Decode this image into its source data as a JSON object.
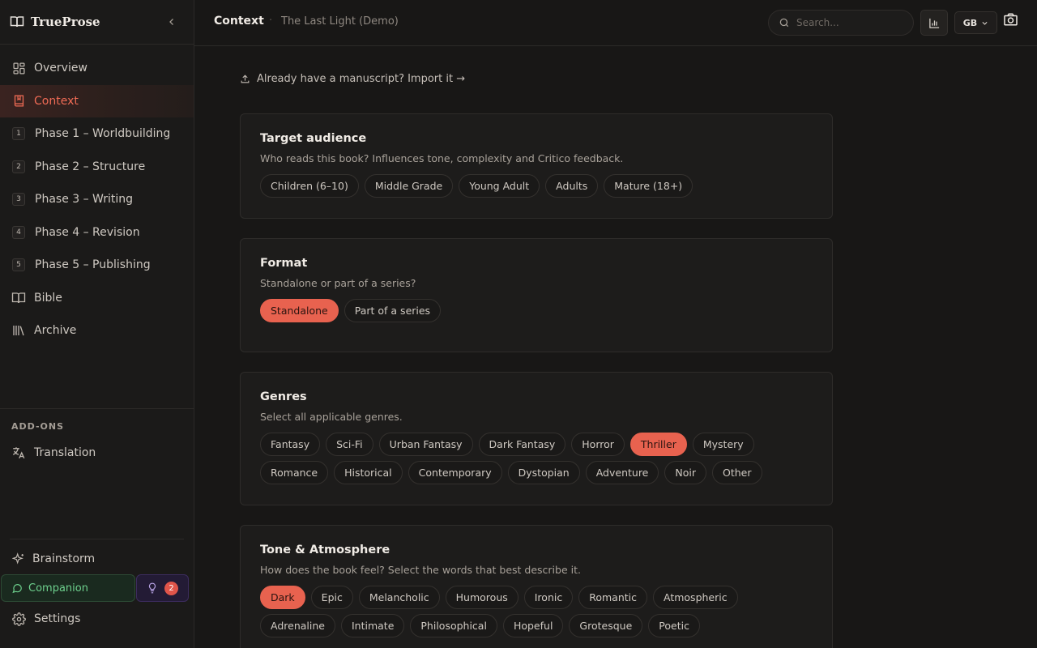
{
  "app": {
    "name": "TrueProse"
  },
  "sidebar": {
    "nav": [
      {
        "label": "Overview",
        "icon": "grid-icon"
      },
      {
        "label": "Context",
        "icon": "book-bookmark-icon",
        "active": true
      },
      {
        "label": "Phase 1 – Worldbuilding",
        "badge": "1"
      },
      {
        "label": "Phase 2 – Structure",
        "badge": "2"
      },
      {
        "label": "Phase 3 – Writing",
        "badge": "3"
      },
      {
        "label": "Phase 4 – Revision",
        "badge": "4"
      },
      {
        "label": "Phase 5 – Publishing",
        "badge": "5"
      },
      {
        "label": "Bible",
        "icon": "open-book-icon"
      },
      {
        "label": "Archive",
        "icon": "library-icon"
      }
    ],
    "addons_title": "ADD-ONS",
    "addons": [
      {
        "label": "Translation",
        "icon": "translate-icon"
      }
    ],
    "brainstorm": "Brainstorm",
    "companion": "Companion",
    "tips_count": "2",
    "settings": "Settings"
  },
  "header": {
    "title": "Context",
    "separator": "·",
    "project": "The Last Light (Demo)",
    "search_placeholder": "Search...",
    "language": "GB"
  },
  "main": {
    "import_text": "Already have a manuscript? Import it →",
    "cards": [
      {
        "title": "Target audience",
        "subtitle": "Who reads this book? Influences tone, complexity and Critico feedback.",
        "options": [
          "Children (6–10)",
          "Middle Grade",
          "Young Adult",
          "Adults",
          "Mature (18+)"
        ],
        "selected": []
      },
      {
        "title": "Format",
        "subtitle": "Standalone or part of a series?",
        "options": [
          "Standalone",
          "Part of a series"
        ],
        "selected": [
          "Standalone"
        ]
      },
      {
        "title": "Genres",
        "subtitle": "Select all applicable genres.",
        "options": [
          "Fantasy",
          "Sci-Fi",
          "Urban Fantasy",
          "Dark Fantasy",
          "Horror",
          "Thriller",
          "Mystery",
          "Romance",
          "Historical",
          "Contemporary",
          "Dystopian",
          "Adventure",
          "Noir",
          "Other"
        ],
        "selected": [
          "Thriller"
        ]
      },
      {
        "title": "Tone & Atmosphere",
        "subtitle": "How does the book feel? Select the words that best describe it.",
        "options": [
          "Dark",
          "Epic",
          "Melancholic",
          "Humorous",
          "Ironic",
          "Romantic",
          "Atmospheric",
          "Adrenaline",
          "Intimate",
          "Philosophical",
          "Hopeful",
          "Grotesque",
          "Poetic"
        ],
        "selected": [
          "Dark"
        ]
      }
    ]
  },
  "colors": {
    "accent": "#e8624f",
    "background": "#181716",
    "companion": "#6dd08d"
  }
}
